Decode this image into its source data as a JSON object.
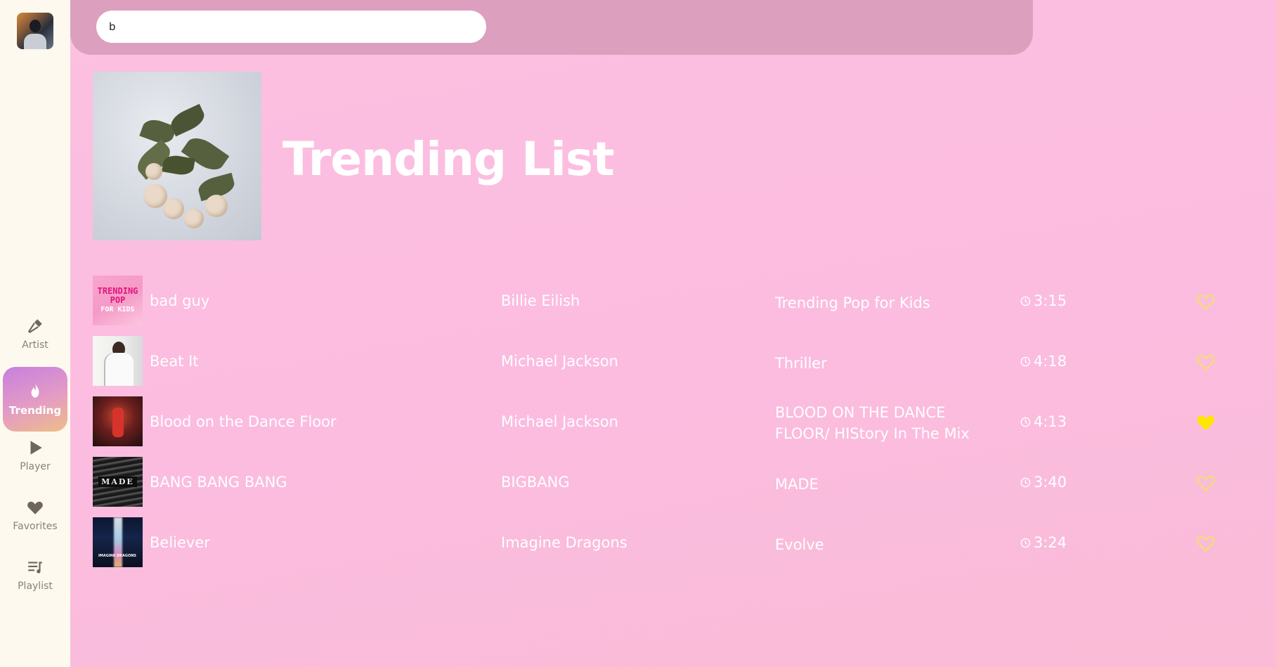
{
  "search": {
    "value": "b"
  },
  "sidebar": {
    "items": [
      {
        "label": "Artist",
        "icon": "microphone-icon"
      },
      {
        "label": "Trending",
        "icon": "fire-icon",
        "active": true
      },
      {
        "label": "Player",
        "icon": "play-icon"
      },
      {
        "label": "Favorites",
        "icon": "heart-icon"
      },
      {
        "label": "Playlist",
        "icon": "playlist-icon"
      }
    ]
  },
  "main": {
    "title": "Trending List",
    "tracks": [
      {
        "title": "bad guy",
        "artist": "Billie Eilish",
        "album": "Trending Pop for Kids",
        "duration": "3:15",
        "favorite": false,
        "thumb_text": [
          "TRENDING",
          "POP",
          "FOR KIDS"
        ]
      },
      {
        "title": "Beat It",
        "artist": "Michael Jackson",
        "album": "Thriller",
        "duration": "4:18",
        "favorite": false
      },
      {
        "title": "Blood on the Dance Floor",
        "artist": "Michael Jackson",
        "album": "BLOOD ON THE DANCE FLOOR/ HIStory In The Mix",
        "duration": "4:13",
        "favorite": true
      },
      {
        "title": "BANG BANG BANG",
        "artist": "BIGBANG",
        "album": "MADE",
        "duration": "3:40",
        "favorite": false,
        "thumb_text": "MADE"
      },
      {
        "title": "Believer",
        "artist": "Imagine Dragons",
        "album": "Evolve",
        "duration": "3:24",
        "favorite": false,
        "thumb_text": "IMAGINE DRAGONS"
      }
    ]
  },
  "colors": {
    "background": "#fdc0e0",
    "header_bar": "#dc9fbe",
    "sidebar": "#fdf9ee",
    "heart_outline": "#f4dd72",
    "heart_filled": "#ffe600"
  }
}
